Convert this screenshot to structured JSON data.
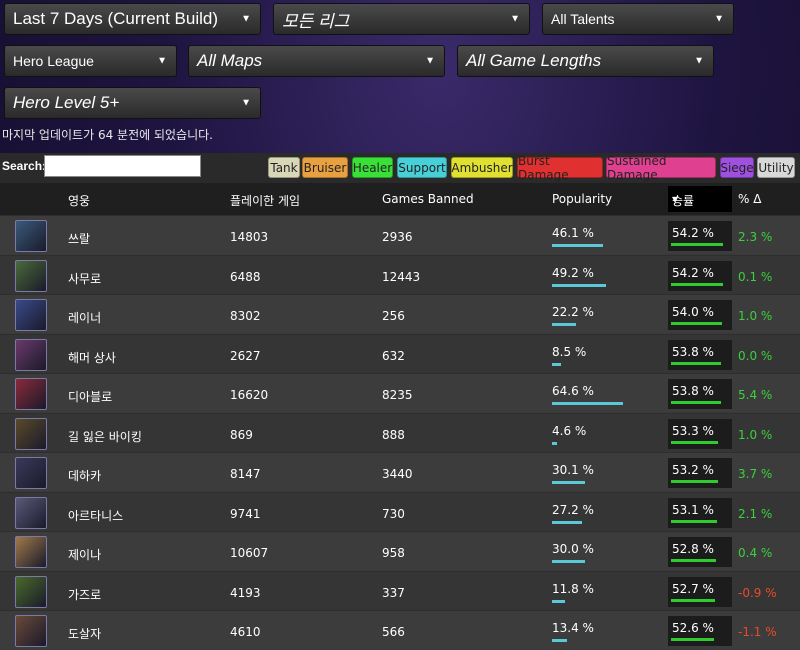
{
  "filters": {
    "time": "Last 7 Days (Current Build)",
    "league": "모든 리그",
    "talents": "All Talents",
    "mode": "Hero League",
    "maps": "All Maps",
    "lengths": "All Game Lengths",
    "level": "Hero Level 5+"
  },
  "updated_text": "마지막 업데이트가 64 분전에 되었습니다.",
  "search": {
    "label": "Search:",
    "value": ""
  },
  "roles": [
    {
      "label": "Tank",
      "color": "#d8d8b8"
    },
    {
      "label": "Bruiser",
      "color": "#e8a040"
    },
    {
      "label": "Healer",
      "color": "#38e038"
    },
    {
      "label": "Support",
      "color": "#48d0d8"
    },
    {
      "label": "Ambusher",
      "color": "#e0e030"
    },
    {
      "label": "Burst Damage",
      "color": "#e03030"
    },
    {
      "label": "Sustained Damage",
      "color": "#e04090"
    },
    {
      "label": "Siege",
      "color": "#a050e0"
    },
    {
      "label": "Utility",
      "color": "#d8d8d8"
    }
  ],
  "columns": {
    "hero": "영웅",
    "games_played": "플레이한 게임",
    "games_banned": "Games Banned",
    "popularity": "Popularity",
    "winrate": "승률",
    "delta": "% Δ"
  },
  "colors": {
    "positive": "#3bd13b",
    "negative": "#e84a2a"
  },
  "rows": [
    {
      "hero": "쓰랄",
      "played": "14803",
      "banned": "2936",
      "popularity": "46.1 %",
      "pop_value": 46.1,
      "winrate": "54.2 %",
      "win_value": 54.2,
      "delta": "2.3 %",
      "delta_sign": "positive",
      "avatar": "#3a5a7a"
    },
    {
      "hero": "사무로",
      "played": "6488",
      "banned": "12443",
      "popularity": "49.2 %",
      "pop_value": 49.2,
      "winrate": "54.2 %",
      "win_value": 54.2,
      "delta": "0.1 %",
      "delta_sign": "positive",
      "avatar": "#4a6a3a"
    },
    {
      "hero": "레이너",
      "played": "8302",
      "banned": "256",
      "popularity": "22.2 %",
      "pop_value": 22.2,
      "winrate": "54.0 %",
      "win_value": 54.0,
      "delta": "1.0 %",
      "delta_sign": "positive",
      "avatar": "#3a4a8a"
    },
    {
      "hero": "해머 상사",
      "played": "2627",
      "banned": "632",
      "popularity": "8.5 %",
      "pop_value": 8.5,
      "winrate": "53.8 %",
      "win_value": 53.8,
      "delta": "0.0 %",
      "delta_sign": "positive",
      "avatar": "#6a3a6a"
    },
    {
      "hero": "디아블로",
      "played": "16620",
      "banned": "8235",
      "popularity": "64.6 %",
      "pop_value": 64.6,
      "winrate": "53.8 %",
      "win_value": 53.8,
      "delta": "5.4 %",
      "delta_sign": "positive",
      "avatar": "#8a2a3a"
    },
    {
      "hero": "길 잃은 바이킹",
      "played": "869",
      "banned": "888",
      "popularity": "4.6 %",
      "pop_value": 4.6,
      "winrate": "53.3 %",
      "win_value": 53.3,
      "delta": "1.0 %",
      "delta_sign": "positive",
      "avatar": "#5a4a2a"
    },
    {
      "hero": "데하카",
      "played": "8147",
      "banned": "3440",
      "popularity": "30.1 %",
      "pop_value": 30.1,
      "winrate": "53.2 %",
      "win_value": 53.2,
      "delta": "3.7 %",
      "delta_sign": "positive",
      "avatar": "#3a3a5a"
    },
    {
      "hero": "아르타니스",
      "played": "9741",
      "banned": "730",
      "popularity": "27.2 %",
      "pop_value": 27.2,
      "winrate": "53.1 %",
      "win_value": 53.1,
      "delta": "2.1 %",
      "delta_sign": "positive",
      "avatar": "#5a5a7a"
    },
    {
      "hero": "제이나",
      "played": "10607",
      "banned": "958",
      "popularity": "30.0 %",
      "pop_value": 30.0,
      "winrate": "52.8 %",
      "win_value": 52.8,
      "delta": "0.4 %",
      "delta_sign": "positive",
      "avatar": "#a07a4a"
    },
    {
      "hero": "가즈로",
      "played": "4193",
      "banned": "337",
      "popularity": "11.8 %",
      "pop_value": 11.8,
      "winrate": "52.7 %",
      "win_value": 52.7,
      "delta": "-0.9 %",
      "delta_sign": "negative",
      "avatar": "#4a6a2a"
    },
    {
      "hero": "도살자",
      "played": "4610",
      "banned": "566",
      "popularity": "13.4 %",
      "pop_value": 13.4,
      "winrate": "52.6 %",
      "win_value": 52.6,
      "delta": "-1.1 %",
      "delta_sign": "negative",
      "avatar": "#6a4a3a"
    }
  ]
}
